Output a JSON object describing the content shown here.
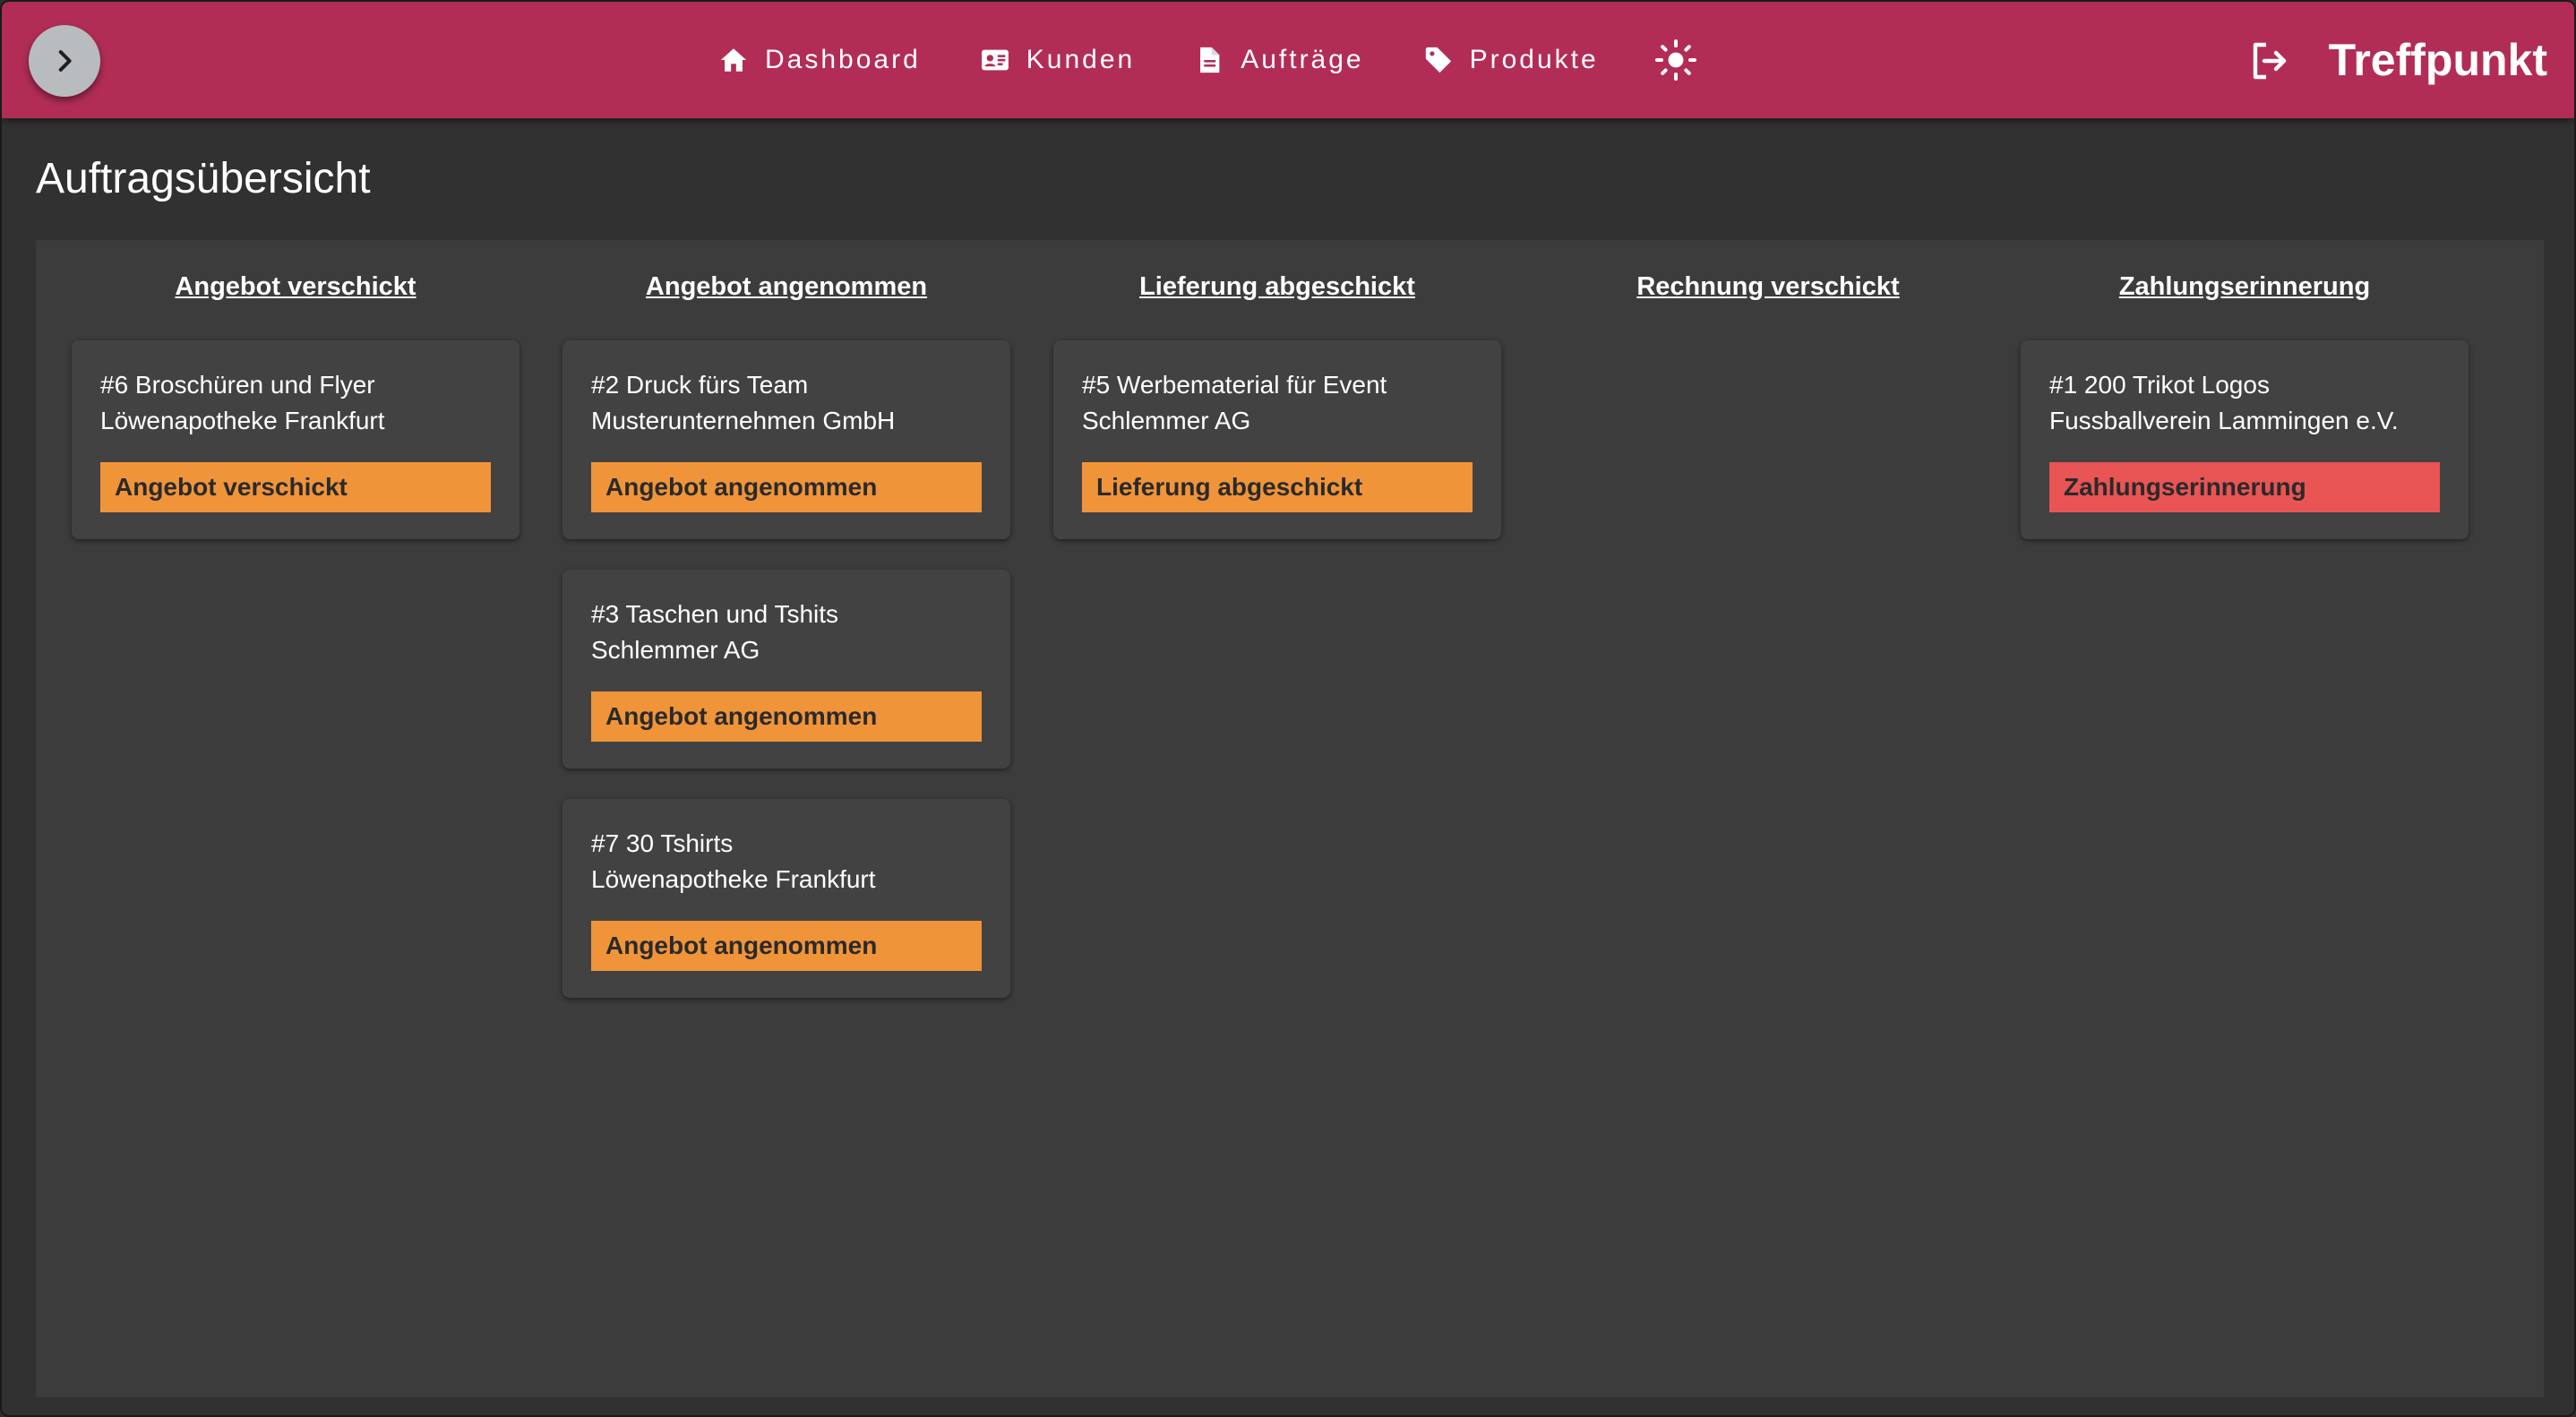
{
  "header": {
    "nav": [
      {
        "label": "Dashboard",
        "icon": "home-icon"
      },
      {
        "label": "Kunden",
        "icon": "contact-card-icon"
      },
      {
        "label": "Aufträge",
        "icon": "document-icon"
      },
      {
        "label": "Produkte",
        "icon": "tag-icon"
      }
    ],
    "theme_icon": "sun-icon",
    "logout_icon": "logout-icon",
    "brand": "Treffpunkt",
    "color": "#b22d56"
  },
  "page": {
    "title": "Auftragsübersicht"
  },
  "board": {
    "columns": [
      {
        "title": "Angebot verschickt",
        "cards": [
          {
            "title": "#6 Broschüren und Flyer",
            "customer": "Löwenapotheke Frankfurt",
            "status": "Angebot verschickt",
            "status_color": "#f0943a"
          }
        ]
      },
      {
        "title": "Angebot angenommen",
        "cards": [
          {
            "title": "#2 Druck fürs Team",
            "customer": "Musterunternehmen GmbH",
            "status": "Angebot angenommen",
            "status_color": "#f0943a"
          },
          {
            "title": "#3 Taschen und Tshits",
            "customer": "Schlemmer AG",
            "status": "Angebot angenommen",
            "status_color": "#f0943a"
          },
          {
            "title": "#7 30 Tshirts",
            "customer": "Löwenapotheke Frankfurt",
            "status": "Angebot angenommen",
            "status_color": "#f0943a"
          }
        ]
      },
      {
        "title": "Lieferung abgeschickt",
        "cards": [
          {
            "title": "#5 Werbematerial für Event",
            "customer": "Schlemmer AG",
            "status": "Lieferung abgeschickt",
            "status_color": "#f0943a"
          }
        ]
      },
      {
        "title": "Rechnung verschickt",
        "cards": []
      },
      {
        "title": "Zahlungserinnerung",
        "cards": [
          {
            "title": "#1 200 Trikot Logos",
            "customer": "Fussballverein Lammingen e.V.",
            "status": "Zahlungserinnerung",
            "status_color": "#e95454"
          }
        ]
      }
    ]
  }
}
